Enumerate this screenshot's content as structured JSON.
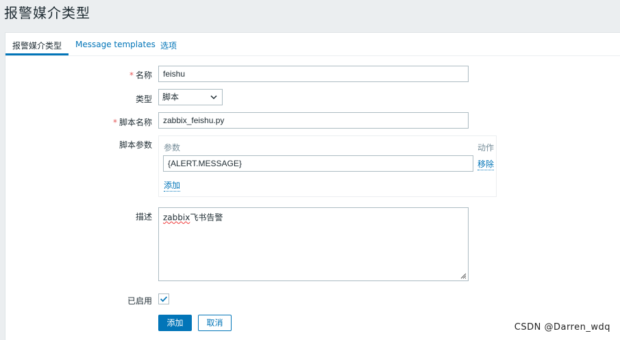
{
  "page": {
    "title": "报警媒介类型"
  },
  "tabs": [
    {
      "label": "报警媒介类型",
      "active": true
    },
    {
      "label": "Message templates",
      "active": false
    },
    {
      "label": "选项",
      "active": false
    }
  ],
  "form": {
    "name": {
      "label": "名称",
      "required_mark": "*",
      "value": "feishu"
    },
    "type": {
      "label": "类型",
      "value": "脚本"
    },
    "script_name": {
      "label": "脚本名称",
      "required_mark": "*",
      "value": "zabbix_feishu.py"
    },
    "script_params": {
      "label": "脚本参数",
      "col_param": "参数",
      "col_action": "动作",
      "rows": [
        {
          "value": "{ALERT.MESSAGE}",
          "remove_label": "移除"
        }
      ],
      "add_label": "添加"
    },
    "description": {
      "label": "描述",
      "value_word1": "zabbix",
      "value_word2": "飞书告警"
    },
    "enabled": {
      "label": "已启用",
      "checked": true
    }
  },
  "buttons": {
    "add": "添加",
    "cancel": "取消"
  },
  "watermark": "CSDN @Darren_wdq",
  "colors": {
    "accent": "#0275b8",
    "required": "#e45959",
    "page_bg": "#ebeef0"
  }
}
